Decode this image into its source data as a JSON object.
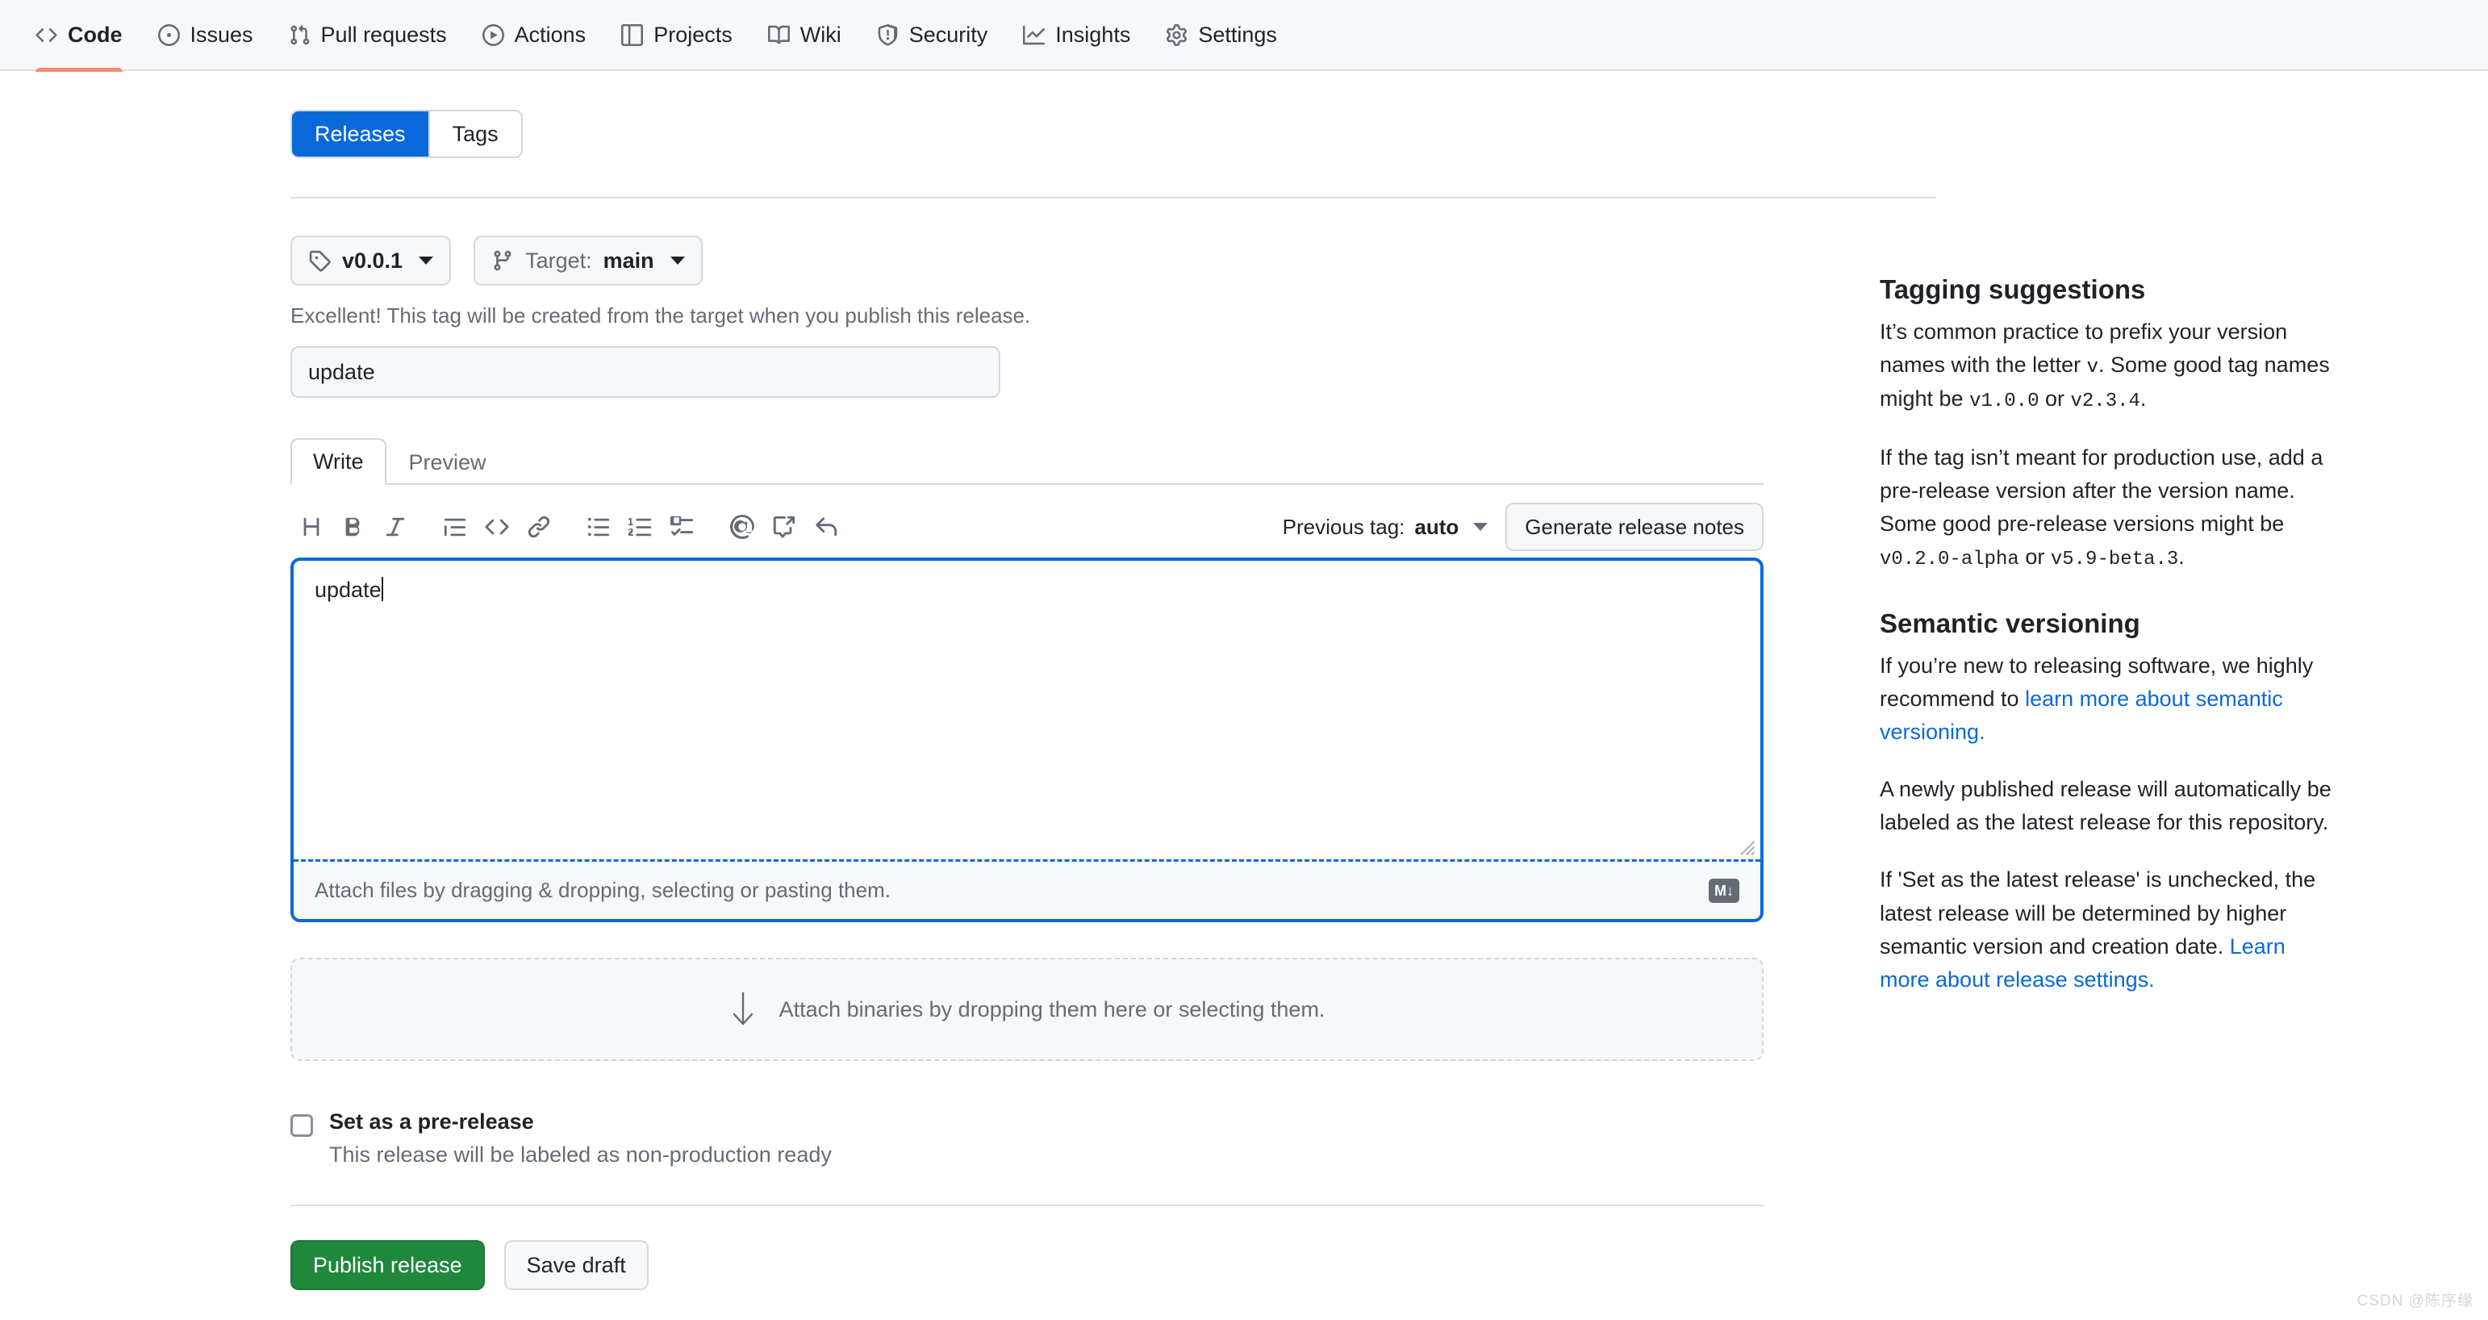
{
  "repo_nav": {
    "items": [
      {
        "label": "Code",
        "icon": "code-icon",
        "active": true
      },
      {
        "label": "Issues",
        "icon": "issue-opened-icon",
        "active": false
      },
      {
        "label": "Pull requests",
        "icon": "git-pull-request-icon",
        "active": false
      },
      {
        "label": "Actions",
        "icon": "play-icon",
        "active": false
      },
      {
        "label": "Projects",
        "icon": "table-icon",
        "active": false
      },
      {
        "label": "Wiki",
        "icon": "book-icon",
        "active": false
      },
      {
        "label": "Security",
        "icon": "shield-icon",
        "active": false
      },
      {
        "label": "Insights",
        "icon": "graph-icon",
        "active": false
      },
      {
        "label": "Settings",
        "icon": "gear-icon",
        "active": false
      }
    ]
  },
  "segmented": {
    "releases_label": "Releases",
    "tags_label": "Tags",
    "active": "Releases"
  },
  "tag_row": {
    "tag_value": "v0.0.1",
    "target_label": "Target:",
    "target_value": "main"
  },
  "helper_text": "Excellent! This tag will be created from the target when you publish this release.",
  "release_title": {
    "value": "update",
    "placeholder": "Release title"
  },
  "editor": {
    "tabs": [
      {
        "label": "Write",
        "active": true
      },
      {
        "label": "Preview",
        "active": false
      }
    ],
    "toolbar_icons": [
      "heading-icon",
      "bold-icon",
      "italic-icon",
      "quote-icon",
      "code-icon",
      "link-icon",
      "unordered-list-icon",
      "ordered-list-icon",
      "task-list-icon",
      "mention-icon",
      "cross-reference-icon",
      "reply-icon"
    ],
    "previous_tag_label": "Previous tag:",
    "previous_tag_value": "auto",
    "generate_notes_label": "Generate release notes",
    "body_value": "update",
    "body_placeholder": "Describe this release",
    "attach_hint": "Attach files by dragging & dropping, selecting or pasting them.",
    "markdown_badge": "M↓"
  },
  "dropzone": {
    "text": "Attach binaries by dropping them here or selecting them.",
    "icon": "down-arrow-icon"
  },
  "prerelease": {
    "checked": false,
    "title": "Set as a pre-release",
    "subtitle": "This release will be labeled as non-production ready"
  },
  "actions": {
    "publish_label": "Publish release",
    "draft_label": "Save draft"
  },
  "sidebar": {
    "tagging_heading": "Tagging suggestions",
    "tagging_p1_a": "It’s common practice to prefix your version names with the letter ",
    "tagging_p1_code1": "v",
    "tagging_p1_b": ". Some good tag names might be ",
    "tagging_p1_code2": "v1.0.0",
    "tagging_p1_c": " or ",
    "tagging_p1_code3": "v2.3.4",
    "tagging_p1_d": ".",
    "tagging_p2_a": "If the tag isn’t meant for production use, add a pre-release version after the version name. Some good pre-release versions might be ",
    "tagging_p2_code1": "v0.2.0-alpha",
    "tagging_p2_b": " or ",
    "tagging_p2_code2": "v5.9-beta.3",
    "tagging_p2_c": ".",
    "semver_heading": "Semantic versioning",
    "semver_p1_a": "If you’re new to releasing software, we highly recommend to ",
    "semver_p1_link": "learn more about semantic versioning.",
    "semver_p2": "A newly published release will automatically be labeled as the latest release for this repository.",
    "semver_p3_a": "If 'Set as the latest release' is unchecked, the latest release will be determined by higher semantic version and creation date. ",
    "semver_p3_link": "Learn more about release settings."
  },
  "watermark": "CSDN @陈序缘",
  "colors": {
    "accent_blue": "#0969da",
    "success_green": "#1f883d",
    "active_tab_underline": "#fd8c73",
    "muted_text": "#636c76",
    "border": "#d0d7de"
  }
}
